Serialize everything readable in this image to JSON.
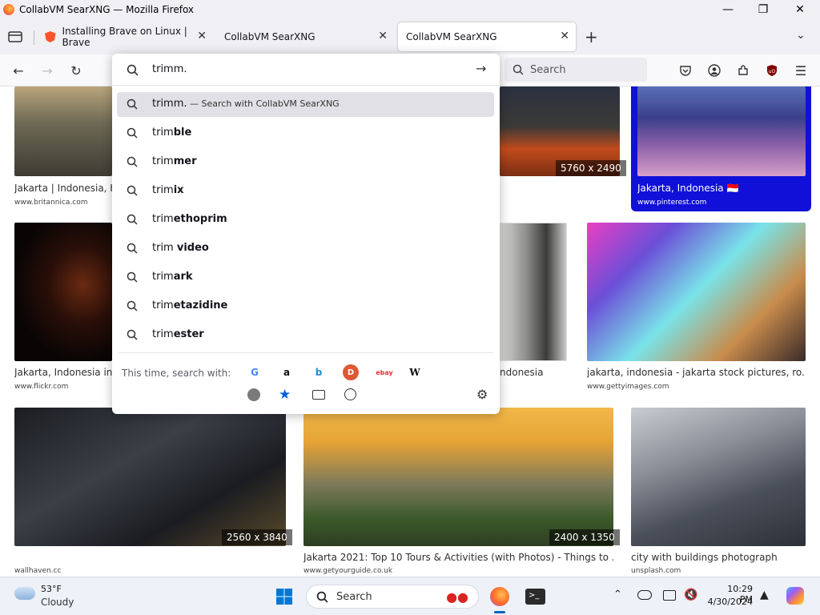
{
  "window": {
    "title": "CollabVM SearXNG — Mozilla Firefox"
  },
  "tabs": [
    {
      "label": "Installing Brave on Linux | Brave"
    },
    {
      "label": "CollabVM SearXNG"
    },
    {
      "label": "CollabVM SearXNG"
    }
  ],
  "toolbar": {
    "search_placeholder": "Search"
  },
  "urlbar": {
    "value": "trimm."
  },
  "suggestions": [
    {
      "prefix": "trimm.",
      "bold": "",
      "suffix": " — Search with CollabVM SearXNG"
    },
    {
      "prefix": "trim",
      "bold": "ble",
      "suffix": ""
    },
    {
      "prefix": "trim",
      "bold": "mer",
      "suffix": ""
    },
    {
      "prefix": "trim",
      "bold": "ix",
      "suffix": ""
    },
    {
      "prefix": "trim",
      "bold": "ethoprim",
      "suffix": ""
    },
    {
      "prefix": "trim ",
      "bold": "video",
      "suffix": ""
    },
    {
      "prefix": "trim",
      "bold": "ark",
      "suffix": ""
    },
    {
      "prefix": "trim",
      "bold": "etazidine",
      "suffix": ""
    },
    {
      "prefix": "trim",
      "bold": "ester",
      "suffix": ""
    }
  ],
  "one_off": {
    "label": "This time, search with:",
    "engines": [
      "G",
      "a",
      "b",
      "D",
      "ebay",
      "W"
    ]
  },
  "results": [
    {
      "title": "Jakarta | Indonesia, H",
      "source": "www.britannica.com"
    },
    {
      "dims": "5760 x 2490"
    },
    {
      "title": "Jakarta, Indonesia 🇮🇩",
      "source": "www.pinterest.com"
    },
    {
      "title": "Jakarta, Indonesia in",
      "source": "www.flickr.com"
    },
    {
      "title": "ndonesia"
    },
    {
      "title": "jakarta, indonesia - jakarta stock pictures, ro...",
      "source": "www.gettyimages.com"
    },
    {
      "dims": "2560 x 3840",
      "source": "wallhaven.cc"
    },
    {
      "title": "Jakarta 2021: Top 10 Tours & Activities (with Photos) - Things to ...",
      "dims": "2400 x 1350",
      "source": "www.getyourguide.co.uk"
    },
    {
      "title": "city with buildings photograph",
      "source": "unsplash.com"
    }
  ],
  "taskbar": {
    "weather_temp": "53°F",
    "weather_desc": "Cloudy",
    "search_label": "Search",
    "time": "10:29 PM",
    "date": "4/30/2024"
  },
  "colors": {
    "accent": "#0060df",
    "pinterest_bg": "#1010d8",
    "tab_bg": "#f0f0f4"
  }
}
